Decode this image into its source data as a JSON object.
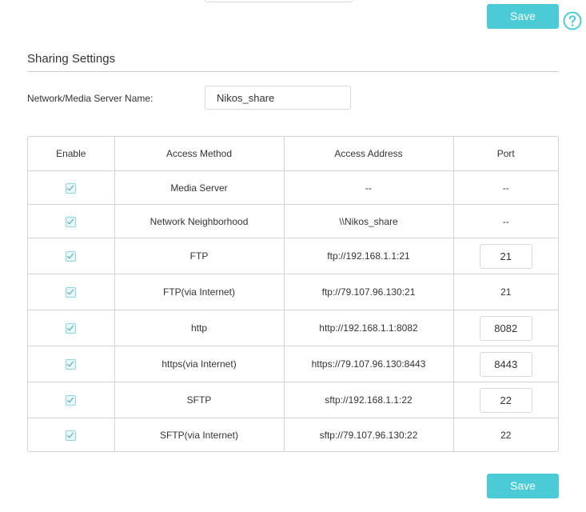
{
  "toolbar": {
    "save_label": "Save"
  },
  "footer": {
    "save_label": "Save"
  },
  "help_icon": "question-circle-icon",
  "accent_color": "#4acbd6",
  "sharing": {
    "title": "Sharing Settings",
    "server_name_label": "Network/Media Server Name:",
    "server_name_value": "Nikos_share"
  },
  "table": {
    "headers": [
      "Enable",
      "Access Method",
      "Access Address",
      "Port"
    ],
    "rows": [
      {
        "enabled": true,
        "method": "Media Server",
        "address": "--",
        "port": "--",
        "port_editable": false
      },
      {
        "enabled": true,
        "method": "Network Neighborhood",
        "address": "\\\\Nikos_share",
        "port": "--",
        "port_editable": false
      },
      {
        "enabled": true,
        "method": "FTP",
        "address": "ftp://192.168.1.1:21",
        "port": "21",
        "port_editable": true
      },
      {
        "enabled": true,
        "method": "FTP(via Internet)",
        "address": "ftp://79.107.96.130:21",
        "port": "21",
        "port_editable": false
      },
      {
        "enabled": true,
        "method": "http",
        "address": "http://192.168.1.1:8082",
        "port": "8082",
        "port_editable": true
      },
      {
        "enabled": true,
        "method": "https(via Internet)",
        "address": "https://79.107.96.130:8443",
        "port": "8443",
        "port_editable": true
      },
      {
        "enabled": true,
        "method": "SFTP",
        "address": "sftp://192.168.1.1:22",
        "port": "22",
        "port_editable": true
      },
      {
        "enabled": true,
        "method": "SFTP(via Internet)",
        "address": "sftp://79.107.96.130:22",
        "port": "22",
        "port_editable": false
      }
    ]
  }
}
